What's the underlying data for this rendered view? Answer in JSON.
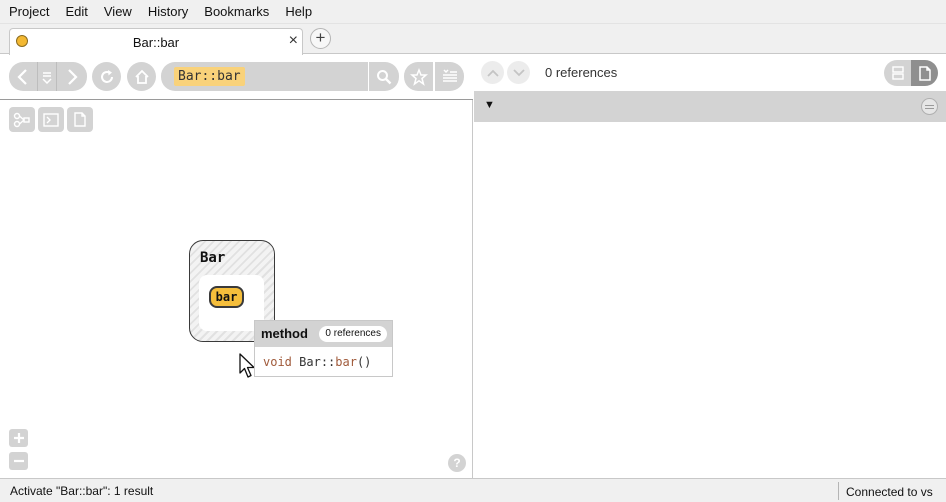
{
  "menu": [
    "Project",
    "Edit",
    "View",
    "History",
    "Bookmarks",
    "Help"
  ],
  "tab": {
    "title": "Bar::bar",
    "close": "×",
    "dot_color": "#f3b832"
  },
  "add_tab": "+",
  "search": {
    "query": "Bar::bar"
  },
  "graph": {
    "class_name": "Bar",
    "method_name": "bar",
    "method_color": "#f5be3b"
  },
  "tooltip": {
    "kind": "method",
    "refs": "0 references",
    "code": {
      "return_type": "void",
      "scope": "Bar::",
      "name": "bar",
      "params": "()"
    }
  },
  "help": "?",
  "references": {
    "count": "0 references",
    "toggle": "▼"
  },
  "status": {
    "message": "Activate \"Bar::bar\": 1 result",
    "connection": "Connected to vs"
  },
  "icons": {
    "back": "chevron-left-icon",
    "history": "history-list-icon",
    "forward": "chevron-right-icon",
    "refresh": "refresh-icon",
    "home": "home-icon",
    "search": "search-icon",
    "bookmark": "star-icon",
    "bookmark_manager": "bookmark-list-icon",
    "graph_layout": "graph-icon",
    "terminal": "terminal-icon",
    "file": "file-icon",
    "zoom_in": "plus-icon",
    "zoom_out": "minus-icon",
    "prev_ref": "chevron-up-icon",
    "next_ref": "chevron-down-icon",
    "list_view": "list-view-icon",
    "file_view": "file-view-icon"
  }
}
